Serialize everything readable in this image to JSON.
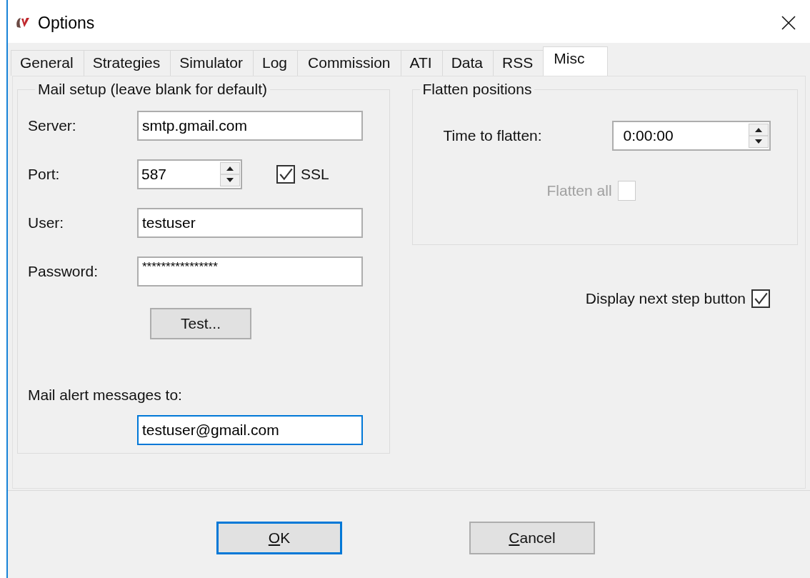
{
  "window": {
    "title": "Options"
  },
  "tabs": [
    {
      "label": "General",
      "selected": false
    },
    {
      "label": "Strategies",
      "selected": false
    },
    {
      "label": "Simulator",
      "selected": false
    },
    {
      "label": "Log",
      "selected": false
    },
    {
      "label": "Commission",
      "selected": false
    },
    {
      "label": "ATI",
      "selected": false
    },
    {
      "label": "Data",
      "selected": false
    },
    {
      "label": "RSS",
      "selected": false
    },
    {
      "label": "Misc",
      "selected": true
    }
  ],
  "mail_setup": {
    "title": "Mail setup (leave blank for default)",
    "server": {
      "label": "Server:",
      "value": "smtp.gmail.com"
    },
    "port": {
      "label": "Port:",
      "value": "587"
    },
    "ssl": {
      "label": "SSL",
      "checked": true
    },
    "user": {
      "label": "User:",
      "value": "testuser"
    },
    "password": {
      "label": "Password:",
      "value": "****************"
    },
    "test_button": "Test...",
    "alert_label": "Mail alert messages to:",
    "alert_to": {
      "value": "testuser@gmail.com",
      "focused": true
    }
  },
  "flatten": {
    "title": "Flatten positions",
    "time_label": "Time to flatten:",
    "time_value": "0:00:00",
    "flatten_all": {
      "label": "Flatten all",
      "checked": false,
      "disabled": true
    }
  },
  "display_next_step": {
    "label": "Display next step button",
    "checked": true
  },
  "buttons": [
    {
      "label": "OK",
      "default": true
    },
    {
      "label": "Cancel",
      "default": false
    }
  ]
}
